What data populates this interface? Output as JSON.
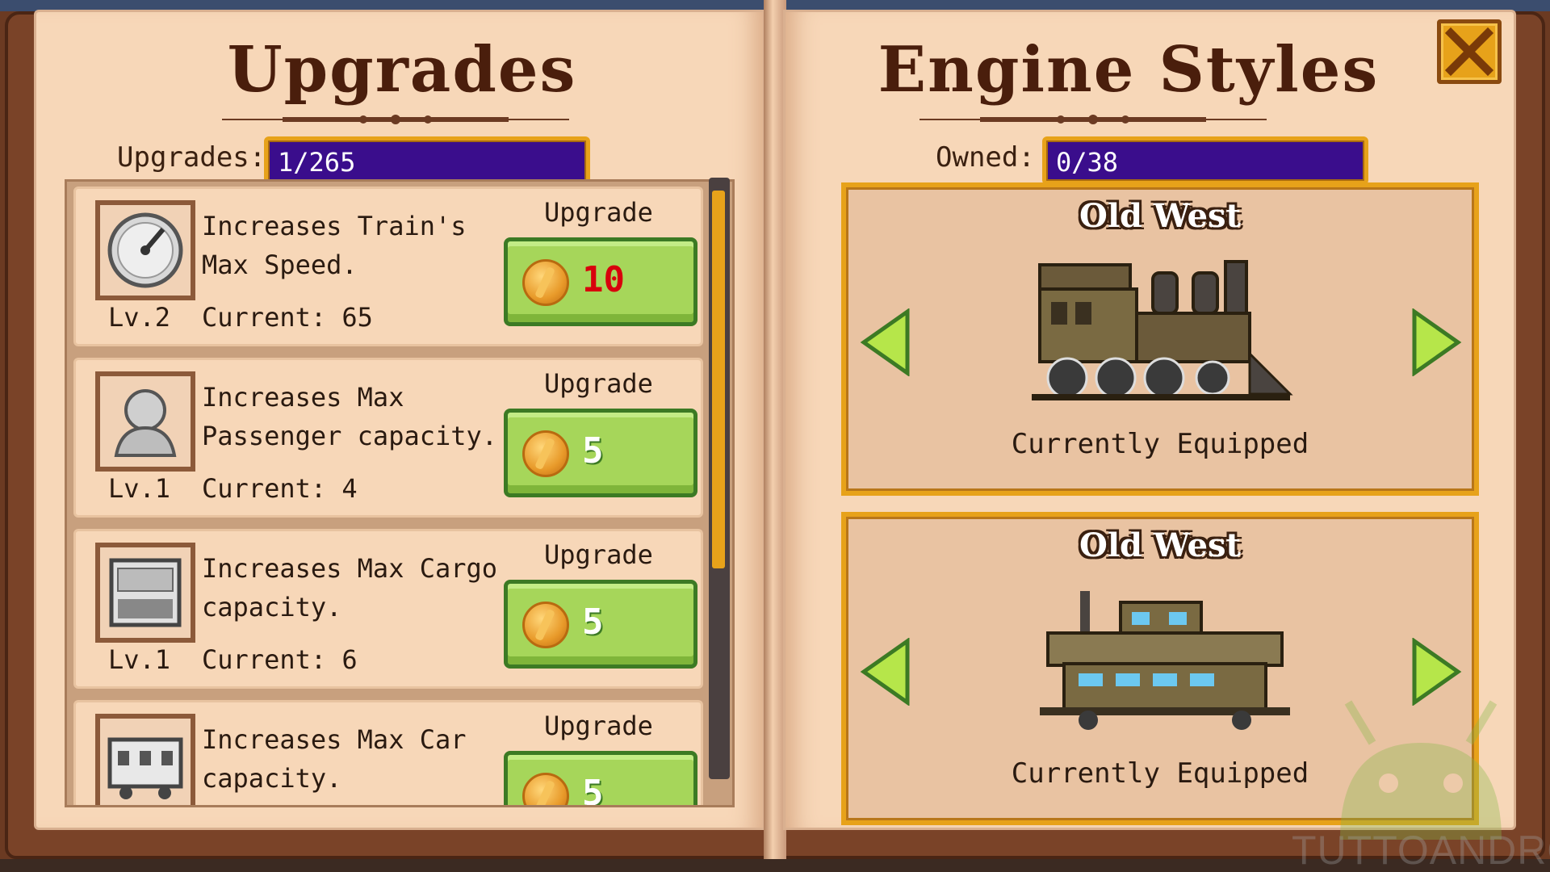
{
  "left_page": {
    "title": "Upgrades",
    "counter_label": "Upgrades:",
    "counter_value": "1/265",
    "items": [
      {
        "icon": "speedometer-icon",
        "description": "Increases Train's Max Speed.",
        "level": "Lv.2",
        "current": "Current: 65",
        "upgrade_label": "Upgrade",
        "price": "10",
        "price_color": "#d8000c"
      },
      {
        "icon": "passenger-icon",
        "description": "Increases Max Passenger capacity.",
        "level": "Lv.1",
        "current": "Current: 4",
        "upgrade_label": "Upgrade",
        "price": "5",
        "price_color": "#ffffff"
      },
      {
        "icon": "cargo-icon",
        "description": "Increases Max Cargo capacity.",
        "level": "Lv.1",
        "current": "Current: 6",
        "upgrade_label": "Upgrade",
        "price": "5",
        "price_color": "#ffffff"
      },
      {
        "icon": "train-car-icon",
        "description": "Increases Max Car capacity.",
        "level": "",
        "current": "",
        "upgrade_label": "Upgrade",
        "price": "5",
        "price_color": "#ffffff"
      }
    ]
  },
  "right_page": {
    "title": "Engine Styles",
    "counter_label": "Owned:",
    "counter_value": "0/38",
    "styles": [
      {
        "name": "Old West",
        "icon": "locomotive-icon",
        "status": "Currently Equipped"
      },
      {
        "name": "Old West",
        "icon": "caboose-icon",
        "status": "Currently Equipped"
      }
    ]
  },
  "close_icon": "close-icon",
  "watermark": "TUTTOANDROID",
  "colors": {
    "accent_gold": "#e7a21a",
    "progress_bar": "#3a0d8c",
    "button_green": "#a6d65a",
    "page_bg": "#f7d7b8",
    "title_brown": "#4a1e0c"
  }
}
